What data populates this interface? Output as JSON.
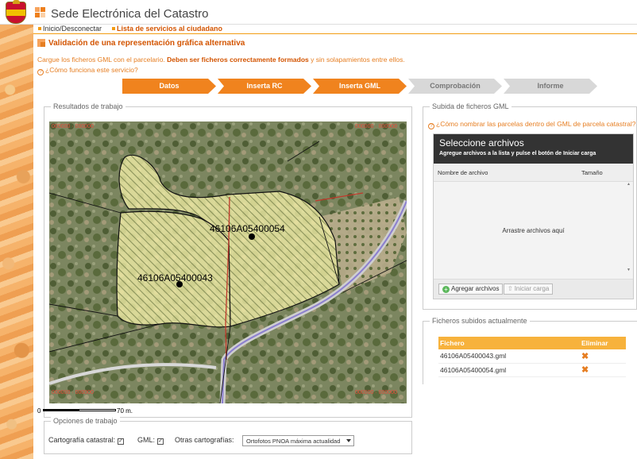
{
  "header": {
    "site_title": "Sede Electrónica del Catastro"
  },
  "nav": {
    "home_label": "Inicio/Desconectar",
    "services_label": "Lista de servicios al ciudadano"
  },
  "page": {
    "title": "Validación de una representación gráfica alternativa",
    "intro_prefix": "Cargue los ficheros GML con el parcelario.",
    "intro_bold": "Deben ser ficheros correctamente formados",
    "intro_suffix": "y sin solapamientos entre ellos.",
    "help_link": "¿Cómo funciona este servicio?"
  },
  "steps": [
    {
      "label": "Datos",
      "state": "active"
    },
    {
      "label": "Inserta RC",
      "state": "active"
    },
    {
      "label": "Inserta GML",
      "state": "active"
    },
    {
      "label": "Comprobación",
      "state": "inactive"
    },
    {
      "label": "Informe",
      "state": "inactive"
    }
  ],
  "results": {
    "legend": "Resultados de trabajo",
    "parcel_labels": [
      "46106A05400054",
      "46106A05400043"
    ],
    "scale_zero": "0",
    "scale_label": "70 m."
  },
  "options": {
    "legend": "Opciones de trabajo",
    "cartografia_label": "Cartografía catastral:",
    "cartografia_checked": true,
    "gml_label": "GML:",
    "gml_checked": true,
    "otras_label": "Otras cartografías:",
    "otras_value": "Ortofotos PNOA máxima actualidad"
  },
  "upload": {
    "legend": "Subida de ficheros GML",
    "help_link": "¿Cómo nombrar las parcelas dentro del GML de parcela catastral?",
    "title": "Seleccione archivos",
    "subtitle": "Agregue archivos a la lista y pulse el botón de Iniciar carga",
    "col_name": "Nombre de archivo",
    "col_size": "Tamaño",
    "drop_text": "Arrastre archivos aquí",
    "add_button": "Agregar archivos",
    "start_button": "Iniciar carga"
  },
  "uploaded": {
    "legend": "Ficheros subidos actualmente",
    "col_file": "Fichero",
    "col_delete": "Eliminar",
    "files": [
      "46106A05400043.gml",
      "46106A05400054.gml"
    ]
  },
  "colors": {
    "accent": "#f0831e",
    "step_inactive": "#d8d8d8",
    "parcel_fill": "#f3f0a8",
    "table_header": "#f7b23c"
  }
}
